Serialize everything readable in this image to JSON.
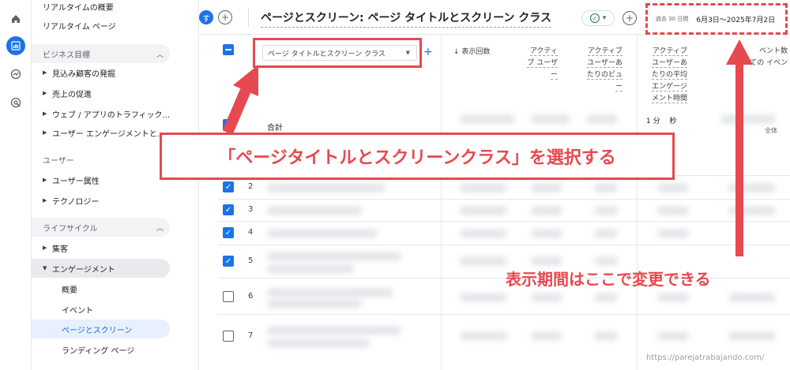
{
  "sidebar": {
    "items": [
      {
        "label": "リアルタイムの概要"
      },
      {
        "label": "リアルタイム ページ"
      },
      {
        "label": "ビジネス目標"
      },
      {
        "label": "見込み顧客の発掘"
      },
      {
        "label": "売上の促進"
      },
      {
        "label": "ウェブ / アプリのトラフィック..."
      },
      {
        "label": "ユーザー エンゲージメントと..."
      },
      {
        "label": "ユーザー"
      },
      {
        "label": "ユーザー属性"
      },
      {
        "label": "テクノロジー"
      },
      {
        "label": "ライフサイクル"
      },
      {
        "label": "集客"
      },
      {
        "label": "エンゲージメント"
      },
      {
        "label": "概要"
      },
      {
        "label": "イベント"
      },
      {
        "label": "ページとスクリーン"
      },
      {
        "label": "ランディング ページ"
      }
    ]
  },
  "header": {
    "avatar_letter": "す",
    "add_symbol": "+",
    "title": "ページとスクリーン: ページ タイトルとスクリーン クラス",
    "date_label": "過去 30 日間",
    "date_range": "6月3日～2025年7月2日"
  },
  "table": {
    "dimension_select": "ページ タイトルとスクリーン クラス",
    "add_dimension": "+",
    "sort_column": "表示回数",
    "columns": [
      {
        "label": "アクティ\nブ ユーザ\nー"
      },
      {
        "label": "アクティブ\nユーザーあ\nたりのビュ\nー"
      },
      {
        "label": "アクティブ\nユーザーあ\nたりの平均\nエンゲージ\nメント時間"
      },
      {
        "label": "ベント数\nすべての イベン"
      }
    ],
    "metric_partial": "1 分 　秒",
    "metric_partial2": "全体",
    "total_label": "合計",
    "rows": [
      {
        "num": "2",
        "checked": true
      },
      {
        "num": "3",
        "checked": true
      },
      {
        "num": "4",
        "checked": true
      },
      {
        "num": "5",
        "checked": true
      },
      {
        "num": "6",
        "checked": false
      },
      {
        "num": "7",
        "checked": false
      }
    ]
  },
  "annotations": {
    "callout": "「ページタイトルとスクリーンクラス」を選択する",
    "period_note": "表示期間はここで変更できる",
    "accent_color": "#e6494f"
  },
  "watermark": "https://parejatrabajando.com/"
}
